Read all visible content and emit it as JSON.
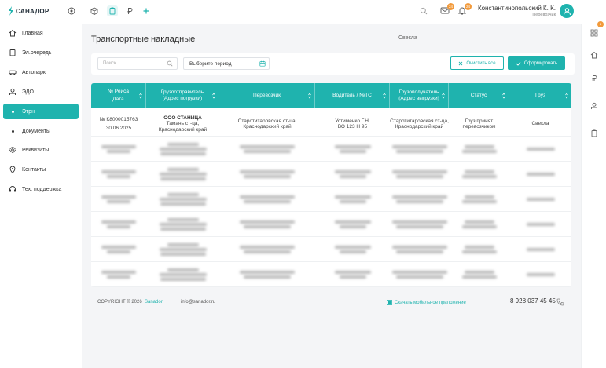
{
  "app": {
    "logo_text": "САНАДОР"
  },
  "topbar": {
    "badge_mail": "24",
    "badge_bell": "24"
  },
  "user": {
    "name": "Константинопольский К. К.",
    "role": "Перевозчик"
  },
  "sidebar": {
    "items": [
      {
        "label": "Главная",
        "icon": "home-icon"
      },
      {
        "label": "Эл.очередь",
        "icon": "clipboard-icon"
      },
      {
        "label": "Автопарк",
        "icon": "truck-icon"
      },
      {
        "label": "ЭДО",
        "icon": "edo-icon"
      },
      {
        "label": "Этрн",
        "icon": "dot"
      },
      {
        "label": "Документы",
        "icon": "dot"
      },
      {
        "label": "Реквизиты",
        "icon": "gear-icon"
      },
      {
        "label": "Контакты",
        "icon": "location-icon"
      },
      {
        "label": "Тех. поддержка",
        "icon": "headset-icon"
      }
    ]
  },
  "rail": {
    "badge": "1"
  },
  "page": {
    "title": "Транспортные накладные",
    "cargo_label": "Свекла"
  },
  "filters": {
    "search_placeholder": "Поиск",
    "period_placeholder": "Выберите период",
    "clear_label": "Очистить все",
    "submit_label": "Сформировать"
  },
  "table": {
    "columns": [
      {
        "line1": "№ Рейса",
        "line2": "Дата"
      },
      {
        "line1": "Грузоотправитель",
        "line2": "(Адрес погрузки)"
      },
      {
        "line1": "Перевозчик",
        "line2": ""
      },
      {
        "line1": "Водитель / №ТС",
        "line2": ""
      },
      {
        "line1": "Грузополучатель",
        "line2": "(Адрес выгрузки)"
      },
      {
        "line1": "Статус",
        "line2": ""
      },
      {
        "line1": "Груз",
        "line2": ""
      }
    ],
    "rows": [
      {
        "c1": [
          "№ К8000015763",
          "30.06.2025"
        ],
        "c2": [
          "ООО СТАНИЦА",
          "Тамань ст-ца,",
          "Краснодарский край"
        ],
        "c3": [
          "Старотитаровская ст-ца,",
          "Краснодарский край"
        ],
        "c4": [
          "Устименко Г.Н.",
          "ВО 123 Н 95"
        ],
        "c5": [
          "Старотитаровская ст-ца,",
          "Краснодарский край"
        ],
        "c6": [
          "Груз принят",
          "перевозчиком"
        ],
        "c7": [
          "Свекла"
        ]
      }
    ]
  },
  "footer": {
    "copyright": "COPYRIGHT © 2026",
    "brand": "Sanador",
    "email": "info@sanador.ru",
    "app_link": "Скачать мобильное приложение",
    "phone": "8 928 037 45 45"
  }
}
